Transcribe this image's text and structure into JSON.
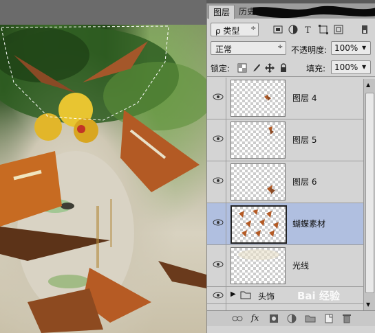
{
  "panel": {
    "tabs": [
      "图层",
      "历史记录"
    ],
    "filter": {
      "label": "ρ 类型",
      "arrow": "÷"
    },
    "blend_mode": "正常",
    "opacity": {
      "label": "不透明度:",
      "value": "100%"
    },
    "lock": {
      "label": "锁定:"
    },
    "fill": {
      "label": "填充:",
      "value": "100%"
    },
    "layers": [
      {
        "name": "图层 4",
        "visible": true,
        "selected": false
      },
      {
        "name": "图层 5",
        "visible": true,
        "selected": false
      },
      {
        "name": "图层 6",
        "visible": true,
        "selected": false
      },
      {
        "name": "蝴蝶素材",
        "visible": true,
        "selected": true
      },
      {
        "name": "光线",
        "visible": true,
        "selected": false
      }
    ],
    "group": {
      "name": "头饰"
    },
    "bottom_icons": [
      "link-icon",
      "fx-icon",
      "mask-icon",
      "adjustment-icon",
      "folder-icon",
      "new-layer-icon",
      "trash-icon"
    ],
    "fx_label": "fx"
  },
  "watermark": "Bai 经验",
  "colors": {
    "panel_bg": "#d4d4d4",
    "selected_row": "#b0bfe0",
    "tab_bar": "#9d9d9d"
  }
}
